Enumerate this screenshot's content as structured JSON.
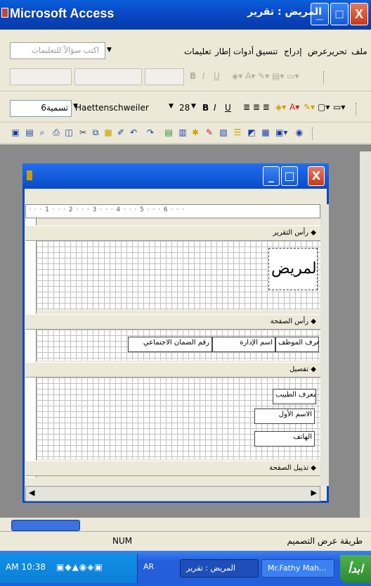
{
  "window": {
    "title": "Microsoft Access",
    "buttons": {
      "minimize": "_",
      "maximize": "□",
      "close": "X"
    }
  },
  "menu": {
    "items": [
      "ملف",
      "تحرير",
      "عرض",
      "إدراج",
      "تنسيق",
      "أدوات",
      "إطار",
      "تعليمات"
    ],
    "help_placeholder": "اكتب سؤالاً للتعليمات"
  },
  "formatting": {
    "object_combo": "تسمية6",
    "font_combo": "Haettenschweiler",
    "size_combo": "28"
  },
  "document": {
    "title": "المريض : تقرير",
    "ruler_marks": [
      "1",
      "2",
      "3",
      "4",
      "5",
      "6"
    ],
    "sections": {
      "report_header": "رأس التقرير",
      "page_header": "رأس الصفحة",
      "detail": "تفصيل",
      "page_footer": "تذييل الصفحة"
    },
    "report_title": "المريض",
    "header_fields": [
      "معرف الموظف",
      "اسم الإدارة",
      "رقم الضمان الاجتماعي"
    ],
    "detail_fields": [
      "معرف الطبيب",
      "الاسم الأول",
      "الهاتف"
    ]
  },
  "status": {
    "mode": "طريقة عرض التصميم",
    "num": "NUM"
  },
  "taskbar": {
    "start": "ابدأ",
    "tasks": [
      "Mr.Fathy Mah...",
      "المريض : تقرير"
    ],
    "clock": "AM 10:38",
    "lang": "AR"
  },
  "colors": {
    "titlebar": "#0a4ac8",
    "taskbar": "#245edb",
    "start": "#3c9a3c",
    "close": "#c8381a"
  }
}
